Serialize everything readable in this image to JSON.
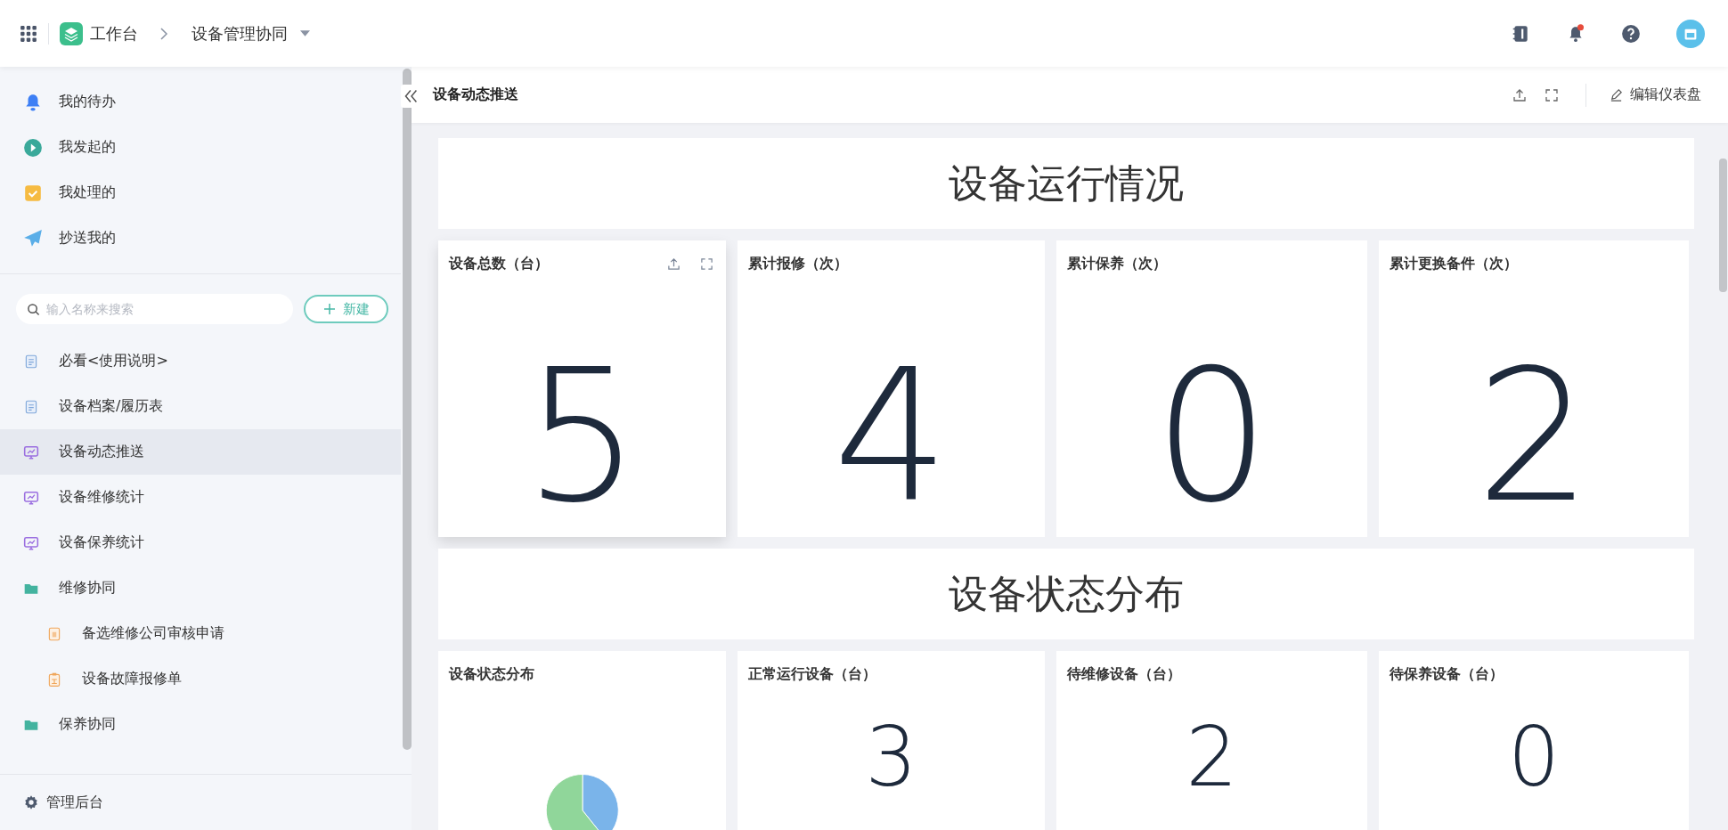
{
  "top_bar": {
    "app_name": "工作台",
    "breadcrumb": "设备管理协同",
    "unread_notifications": true
  },
  "sidebar": {
    "quick_links": [
      {
        "label": "我的待办",
        "kind": "todo"
      },
      {
        "label": "我发起的",
        "kind": "started"
      },
      {
        "label": "我处理的",
        "kind": "handled"
      },
      {
        "label": "抄送我的",
        "kind": "cc"
      }
    ],
    "search": {
      "placeholder": "输入名称来搜索"
    },
    "new_button": "新建",
    "items": [
      {
        "label": "必看<使用说明>",
        "kind": "doc",
        "selected": false
      },
      {
        "label": "设备档案/履历表",
        "kind": "doc",
        "selected": false
      },
      {
        "label": "设备动态推送",
        "kind": "dashboard",
        "selected": true
      },
      {
        "label": "设备维修统计",
        "kind": "dashboard",
        "selected": false
      },
      {
        "label": "设备保养统计",
        "kind": "dashboard",
        "selected": false
      },
      {
        "label": "维修协同",
        "kind": "folder",
        "selected": false,
        "children": [
          {
            "label": "备选维修公司审核申请",
            "kind": "form",
            "selected": false
          },
          {
            "label": "设备故障报修单",
            "kind": "report",
            "selected": false
          }
        ]
      },
      {
        "label": "保养协同",
        "kind": "folder",
        "selected": false
      }
    ],
    "footer": "管理后台"
  },
  "dashboard": {
    "title": "设备动态推送",
    "edit_button": "编辑仪表盘",
    "sections": [
      {
        "heading": "设备运行情况",
        "cards": [
          {
            "title": "设备总数（台）",
            "kind": "number",
            "value": "5",
            "hovered": true
          },
          {
            "title": "累计报修（次）",
            "kind": "number",
            "value": "4",
            "hovered": false
          },
          {
            "title": "累计保养（次）",
            "kind": "number",
            "value": "0",
            "hovered": false
          },
          {
            "title": "累计更换备件（次）",
            "kind": "number",
            "value": "2",
            "hovered": false
          }
        ]
      },
      {
        "heading": "设备状态分布",
        "cards": [
          {
            "title": "设备状态分布",
            "kind": "pie",
            "hovered": false
          },
          {
            "title": "正常运行设备（台）",
            "kind": "number",
            "value": "3",
            "hovered": false
          },
          {
            "title": "待维修设备（台）",
            "kind": "number",
            "value": "2",
            "hovered": false
          },
          {
            "title": "待保养设备（台）",
            "kind": "number",
            "value": "0",
            "hovered": false
          }
        ]
      }
    ]
  }
}
